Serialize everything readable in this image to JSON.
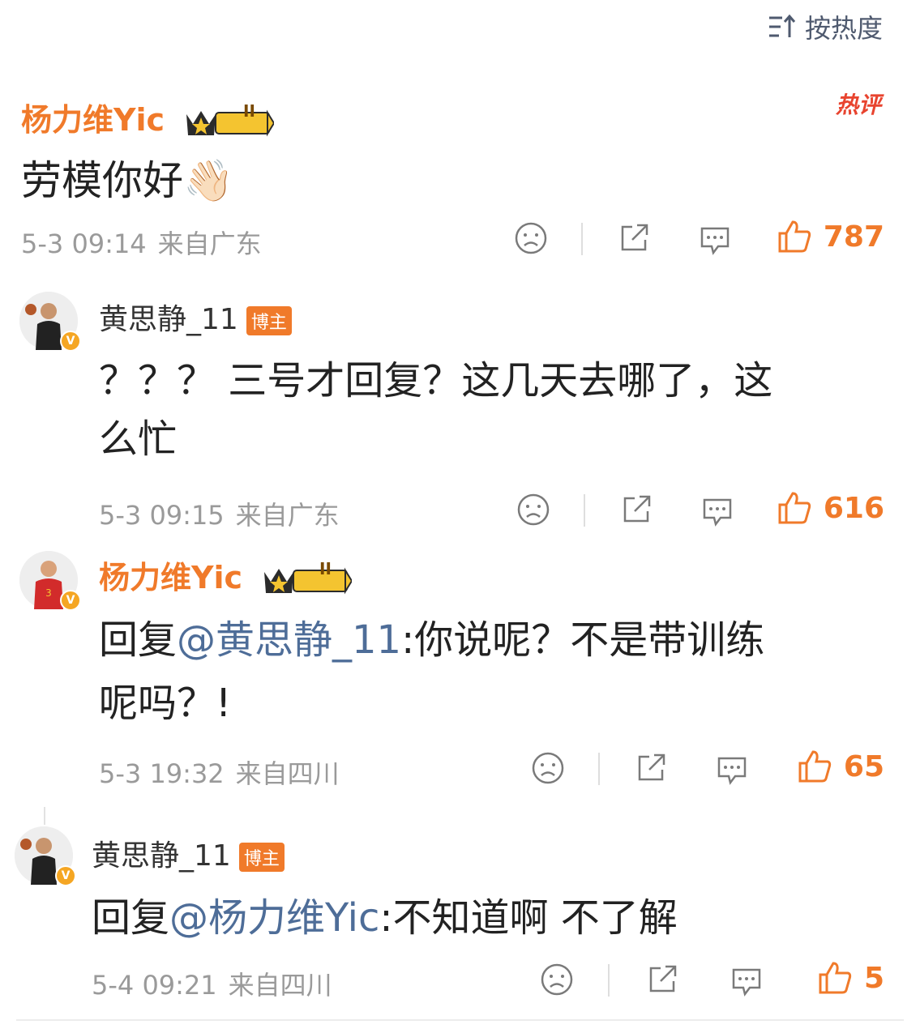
{
  "sort": {
    "label": "按热度"
  },
  "hot_tag": "热评",
  "comments": [
    {
      "username": "杨力维Yic",
      "level": "II",
      "text": "劳模你好",
      "emoji": "👋🏻",
      "time": "5-3 09:14",
      "location": "来自广东",
      "likes": "787"
    },
    {
      "username": "黄思静_11",
      "badge": "博主",
      "text_line1": "？？？ 三号才回复？这几天去哪了，这",
      "text_line2": "么忙",
      "time": "5-3 09:15",
      "location": "来自广东",
      "likes": "616"
    },
    {
      "username": "杨力维Yic",
      "level": "II",
      "reply_prefix": "回复",
      "mention": "@黄思静_11",
      "text_line1": ":你说呢？不是带训练",
      "text_line2": "呢吗？!",
      "time": "5-3 19:32",
      "location": "来自四川",
      "likes": "65"
    },
    {
      "username": "黄思静_11",
      "badge": "博主",
      "reply_prefix": "回复",
      "mention": "@杨力维Yic",
      "text_line1": ":不知道啊 不了解",
      "time": "5-4 09:21",
      "location": "来自四川",
      "likes": "5"
    }
  ],
  "colors": {
    "accent": "#f07a2a",
    "mention": "#4e6d98",
    "meta": "#9a9a9a",
    "hot": "#e8442f"
  },
  "icons": [
    "sort-icon",
    "crown-level-icon",
    "sad-face-icon",
    "share-icon",
    "comment-icon",
    "thumbs-up-icon",
    "verified-badge-icon"
  ]
}
